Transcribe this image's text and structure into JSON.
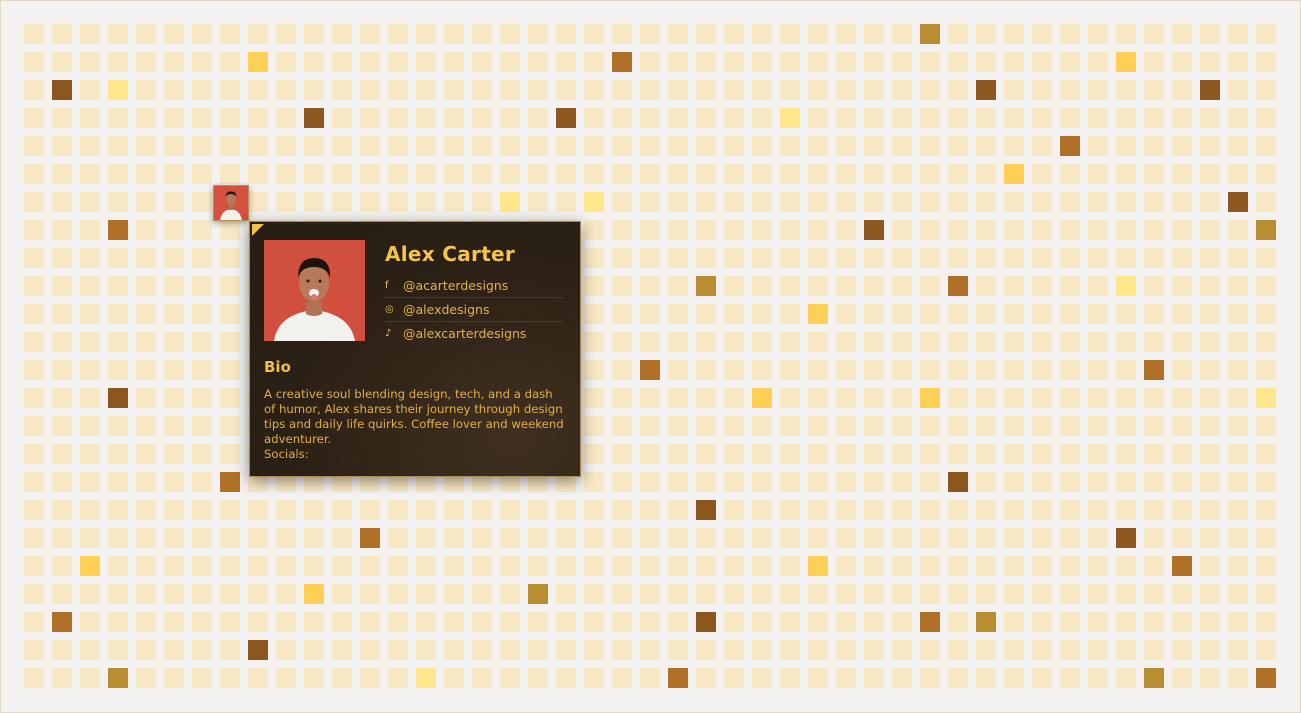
{
  "profile": {
    "name": "Alex Carter",
    "bio_heading": "Bio",
    "bio_text": "A creative soul blending design, tech, and a dash of humor, Alex shares their journey through design tips and daily life quirks. Coffee lover and weekend adventurer.",
    "socials_label": "Socials:",
    "socials": [
      {
        "icon": "facebook-icon",
        "glyph": "f",
        "handle": "@acarterdesigns"
      },
      {
        "icon": "instagram-icon",
        "glyph": "◎",
        "handle": "@alexdesigns"
      },
      {
        "icon": "tiktok-icon",
        "glyph": "♪",
        "handle": "@alexcarterdesigns"
      }
    ]
  },
  "colors": {
    "tile": "#f7e7c3",
    "tile_highlight": "#ffd055",
    "tile_light": "#ffe68a",
    "tile_brown": "#b07028",
    "tile_dark": "#8c5820",
    "tile_ochre": "#b98e33",
    "card_bg": "#2b2015",
    "accent": "#f4c44d"
  },
  "highlighted_tiles": [
    {
      "col": 32,
      "row": 0,
      "tone": "ochre"
    },
    {
      "col": 8,
      "row": 1,
      "tone": "gold"
    },
    {
      "col": 21,
      "row": 1,
      "tone": "brown"
    },
    {
      "col": 39,
      "row": 1,
      "tone": "gold"
    },
    {
      "col": 1,
      "row": 2,
      "tone": "dark"
    },
    {
      "col": 3,
      "row": 2,
      "tone": "light"
    },
    {
      "col": 34,
      "row": 2,
      "tone": "dark"
    },
    {
      "col": 42,
      "row": 2,
      "tone": "dark"
    },
    {
      "col": 10,
      "row": 3,
      "tone": "dark"
    },
    {
      "col": 19,
      "row": 3,
      "tone": "dark"
    },
    {
      "col": 27,
      "row": 3,
      "tone": "light"
    },
    {
      "col": 37,
      "row": 4,
      "tone": "brown"
    },
    {
      "col": 35,
      "row": 5,
      "tone": "gold"
    },
    {
      "col": 17,
      "row": 6,
      "tone": "light"
    },
    {
      "col": 20,
      "row": 6,
      "tone": "light"
    },
    {
      "col": 43,
      "row": 6,
      "tone": "dark"
    },
    {
      "col": 3,
      "row": 7,
      "tone": "brown"
    },
    {
      "col": 30,
      "row": 7,
      "tone": "dark"
    },
    {
      "col": 44,
      "row": 7,
      "tone": "ochre"
    },
    {
      "col": 24,
      "row": 9,
      "tone": "ochre"
    },
    {
      "col": 33,
      "row": 9,
      "tone": "brown"
    },
    {
      "col": 39,
      "row": 9,
      "tone": "light"
    },
    {
      "col": 28,
      "row": 10,
      "tone": "gold"
    },
    {
      "col": 22,
      "row": 12,
      "tone": "brown"
    },
    {
      "col": 40,
      "row": 12,
      "tone": "brown"
    },
    {
      "col": 3,
      "row": 13,
      "tone": "dark"
    },
    {
      "col": 26,
      "row": 13,
      "tone": "gold"
    },
    {
      "col": 32,
      "row": 13,
      "tone": "gold"
    },
    {
      "col": 44,
      "row": 13,
      "tone": "light"
    },
    {
      "col": 7,
      "row": 16,
      "tone": "brown"
    },
    {
      "col": 33,
      "row": 16,
      "tone": "dark"
    },
    {
      "col": 24,
      "row": 17,
      "tone": "dark"
    },
    {
      "col": 12,
      "row": 18,
      "tone": "brown"
    },
    {
      "col": 39,
      "row": 18,
      "tone": "dark"
    },
    {
      "col": 2,
      "row": 19,
      "tone": "gold"
    },
    {
      "col": 28,
      "row": 19,
      "tone": "gold"
    },
    {
      "col": 41,
      "row": 19,
      "tone": "brown"
    },
    {
      "col": 10,
      "row": 20,
      "tone": "gold"
    },
    {
      "col": 18,
      "row": 20,
      "tone": "ochre"
    },
    {
      "col": 1,
      "row": 21,
      "tone": "brown"
    },
    {
      "col": 24,
      "row": 21,
      "tone": "dark"
    },
    {
      "col": 32,
      "row": 21,
      "tone": "brown"
    },
    {
      "col": 34,
      "row": 21,
      "tone": "ochre"
    },
    {
      "col": 8,
      "row": 22,
      "tone": "dark"
    },
    {
      "col": 3,
      "row": 23,
      "tone": "ochre"
    },
    {
      "col": 14,
      "row": 23,
      "tone": "light"
    },
    {
      "col": 23,
      "row": 23,
      "tone": "brown"
    },
    {
      "col": 40,
      "row": 23,
      "tone": "ochre"
    },
    {
      "col": 44,
      "row": 23,
      "tone": "brown"
    }
  ]
}
